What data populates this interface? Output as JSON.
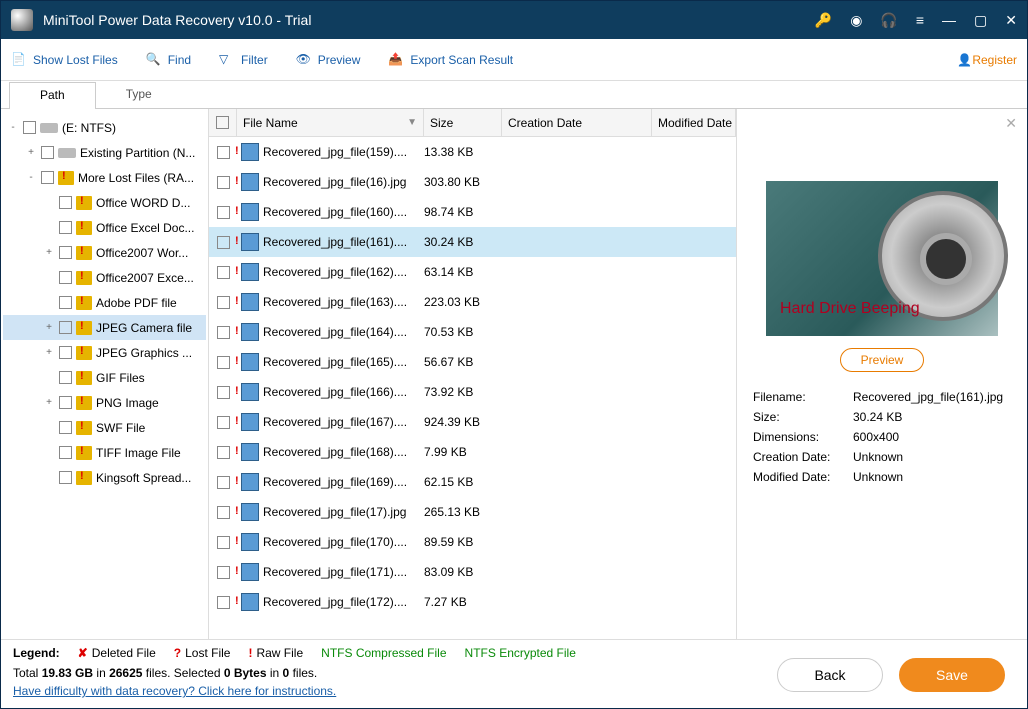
{
  "title": "MiniTool Power Data Recovery v10.0 - Trial",
  "toolbar": {
    "show_lost": "Show Lost Files",
    "find": "Find",
    "filter": "Filter",
    "preview": "Preview",
    "export": "Export Scan Result",
    "register": "Register"
  },
  "tabs": {
    "path": "Path",
    "type": "Type"
  },
  "tree": [
    {
      "indent": 0,
      "exp": "-",
      "ico": "drive",
      "label": "(E: NTFS)"
    },
    {
      "indent": 1,
      "exp": "+",
      "ico": "drive",
      "label": "Existing Partition (N..."
    },
    {
      "indent": 1,
      "exp": "-",
      "ico": "marked",
      "label": "More Lost Files (RA..."
    },
    {
      "indent": 2,
      "exp": "",
      "ico": "marked",
      "label": "Office WORD D..."
    },
    {
      "indent": 2,
      "exp": "",
      "ico": "marked",
      "label": "Office Excel Doc..."
    },
    {
      "indent": 2,
      "exp": "+",
      "ico": "marked",
      "label": "Office2007 Wor..."
    },
    {
      "indent": 2,
      "exp": "",
      "ico": "marked",
      "label": "Office2007 Exce..."
    },
    {
      "indent": 2,
      "exp": "",
      "ico": "marked",
      "label": "Adobe PDF file"
    },
    {
      "indent": 2,
      "exp": "+",
      "ico": "marked",
      "label": "JPEG Camera file",
      "selected": true
    },
    {
      "indent": 2,
      "exp": "+",
      "ico": "marked",
      "label": "JPEG Graphics ..."
    },
    {
      "indent": 2,
      "exp": "",
      "ico": "marked",
      "label": "GIF Files"
    },
    {
      "indent": 2,
      "exp": "+",
      "ico": "marked",
      "label": "PNG Image"
    },
    {
      "indent": 2,
      "exp": "",
      "ico": "marked",
      "label": "SWF File"
    },
    {
      "indent": 2,
      "exp": "",
      "ico": "marked",
      "label": "TIFF Image File"
    },
    {
      "indent": 2,
      "exp": "",
      "ico": "marked",
      "label": "Kingsoft Spread..."
    }
  ],
  "columns": {
    "name": "File Name",
    "size": "Size",
    "cdate": "Creation Date",
    "mdate": "Modified Date"
  },
  "files": [
    {
      "name": "Recovered_jpg_file(159)....",
      "size": "13.38 KB"
    },
    {
      "name": "Recovered_jpg_file(16).jpg",
      "size": "303.80 KB"
    },
    {
      "name": "Recovered_jpg_file(160)....",
      "size": "98.74 KB"
    },
    {
      "name": "Recovered_jpg_file(161)....",
      "size": "30.24 KB",
      "selected": true
    },
    {
      "name": "Recovered_jpg_file(162)....",
      "size": "63.14 KB"
    },
    {
      "name": "Recovered_jpg_file(163)....",
      "size": "223.03 KB"
    },
    {
      "name": "Recovered_jpg_file(164)....",
      "size": "70.53 KB"
    },
    {
      "name": "Recovered_jpg_file(165)....",
      "size": "56.67 KB"
    },
    {
      "name": "Recovered_jpg_file(166)....",
      "size": "73.92 KB"
    },
    {
      "name": "Recovered_jpg_file(167)....",
      "size": "924.39 KB"
    },
    {
      "name": "Recovered_jpg_file(168)....",
      "size": "7.99 KB"
    },
    {
      "name": "Recovered_jpg_file(169)....",
      "size": "62.15 KB"
    },
    {
      "name": "Recovered_jpg_file(17).jpg",
      "size": "265.13 KB"
    },
    {
      "name": "Recovered_jpg_file(170)....",
      "size": "89.59 KB"
    },
    {
      "name": "Recovered_jpg_file(171)....",
      "size": "83.09 KB"
    },
    {
      "name": "Recovered_jpg_file(172)....",
      "size": "7.27 KB"
    }
  ],
  "preview": {
    "caption": "Hard Drive Beeping",
    "button": "Preview",
    "meta": {
      "filename_k": "Filename:",
      "filename_v": "Recovered_jpg_file(161).jpg",
      "size_k": "Size:",
      "size_v": "30.24 KB",
      "dim_k": "Dimensions:",
      "dim_v": "600x400",
      "cdate_k": "Creation Date:",
      "cdate_v": "Unknown",
      "mdate_k": "Modified Date:",
      "mdate_v": "Unknown"
    }
  },
  "legend": {
    "label": "Legend:",
    "deleted": "Deleted File",
    "lost": "Lost File",
    "raw": "Raw File",
    "compressed": "NTFS Compressed File",
    "encrypted": "NTFS Encrypted File"
  },
  "stats": {
    "t1": "Total ",
    "size": "19.83 GB",
    "t2": " in ",
    "files": "26625",
    "t3": " files.  Selected ",
    "sel_bytes": "0 Bytes",
    "t4": " in ",
    "sel_files": "0",
    "t5": " files."
  },
  "help": "Have difficulty with data recovery? Click here for instructions.",
  "buttons": {
    "back": "Back",
    "save": "Save"
  }
}
